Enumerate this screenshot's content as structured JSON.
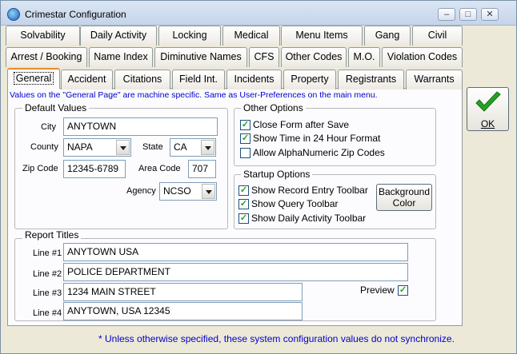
{
  "window": {
    "title": "Crimestar Configuration"
  },
  "tabs": {
    "row1": [
      "Solvability",
      "Daily Activity",
      "Locking",
      "Medical",
      "Menu Items",
      "Gang",
      "Civil"
    ],
    "row2": [
      "Arrest / Booking",
      "Name Index",
      "Diminutive Names",
      "CFS",
      "Other Codes",
      "M.O.",
      "Violation Codes"
    ],
    "row3": [
      "General",
      "Accident",
      "Citations",
      "Field Int.",
      "Incidents",
      "Property",
      "Registrants",
      "Warrants"
    ],
    "active": "General"
  },
  "note": "Values on the \"General Page\" are machine specific.  Same as User-Preferences on the main menu.",
  "default_values": {
    "legend": "Default Values",
    "city_label": "City",
    "city": "ANYTOWN",
    "county_label": "County",
    "county": "NAPA",
    "state_label": "State",
    "state": "CA",
    "zip_label": "Zip Code",
    "zip": "12345-6789",
    "area_code_label": "Area Code",
    "area_code": "707",
    "agency_label": "Agency",
    "agency": "NCSO"
  },
  "other_options": {
    "legend": "Other Options",
    "items": [
      {
        "label": "Close Form after Save",
        "checked": true
      },
      {
        "label": "Show Time in 24 Hour Format",
        "checked": true
      },
      {
        "label": "Allow AlphaNumeric Zip Codes",
        "checked": false
      }
    ]
  },
  "startup_options": {
    "legend": "Startup Options",
    "items": [
      {
        "label": "Show Record Entry Toolbar",
        "checked": true
      },
      {
        "label": "Show Query Toolbar",
        "checked": true
      },
      {
        "label": "Show Daily Activity Toolbar",
        "checked": true
      }
    ],
    "background_button_line1": "Background",
    "background_button_line2": "Color"
  },
  "report_titles": {
    "legend": "Report Titles",
    "line1_label": "Line #1",
    "line1": "ANYTOWN USA",
    "line2_label": "Line #2",
    "line2": "POLICE DEPARTMENT",
    "line3_label": "Line #3",
    "line3": "1234 MAIN STREET",
    "line4_label": "Line #4",
    "line4": "ANYTOWN, USA 12345",
    "preview_label": "Preview",
    "preview_checked": true
  },
  "ok_button": {
    "label": "OK"
  },
  "footer_note": "* Unless otherwise specified, these system configuration values do not synchronize.",
  "colors": {
    "note": "#0000cc",
    "ok_check": "#22a322",
    "active_tab_accent": "#e68b2c"
  }
}
